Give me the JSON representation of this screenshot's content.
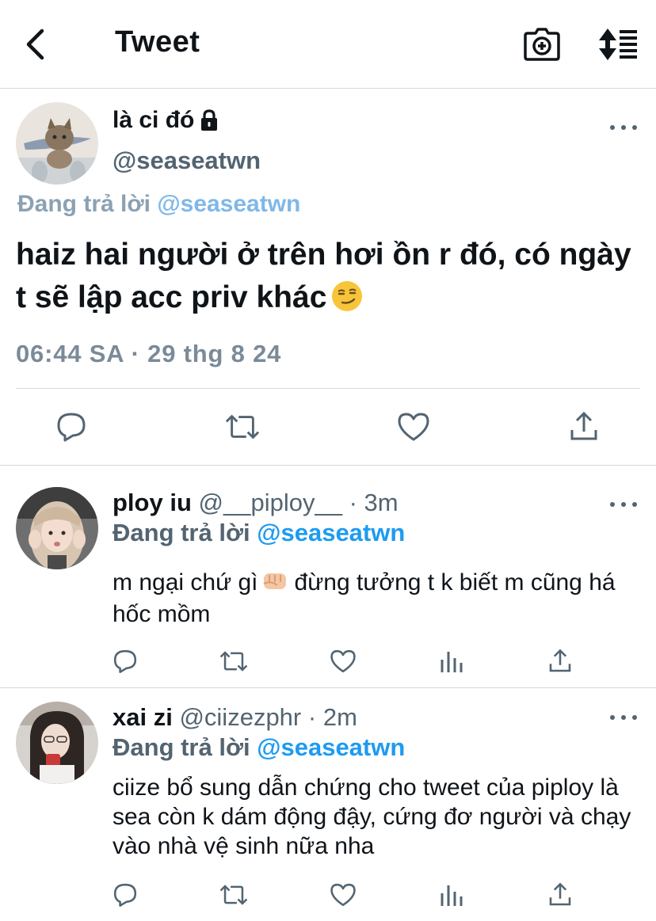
{
  "header": {
    "title": "Tweet",
    "back_icon": "chevron-left-icon",
    "camera_icon": "camera-icon",
    "sort_icon": "sort-icon"
  },
  "main_tweet": {
    "display_name": "là ci đó",
    "handle": "@seaseatwn",
    "replying_prefix": "Đang trả lời",
    "replying_to": "@seaseatwn",
    "text": "haiz hai người ở trên hơi ồn r đó, có ngày t sẽ lập acc priv khác",
    "emoji": "smirking-face",
    "timestamp": "06:44 SA · 29 thg 8 24",
    "actions": [
      "reply-icon",
      "retweet-icon",
      "like-icon",
      "share-icon"
    ]
  },
  "replies": [
    {
      "display_name": "ploy iu",
      "handle": "@__piploy__",
      "dot": "·",
      "time": "3m",
      "replying_prefix": "Đang trả lời",
      "replying_to": "@seaseatwn",
      "text_part1": "m ngại chứ gì",
      "emoji": "fist-emoji",
      "text_part2": "đừng tưởng t k biết m cũng há hốc mồm"
    },
    {
      "display_name": "xai zi",
      "handle": "@ciizezphr",
      "dot": "·",
      "time": "2m",
      "replying_prefix": "Đang trả lời",
      "replying_to": "@seaseatwn",
      "text": "ciize bổ sung dẫn chứng cho tweet của piploy là sea còn k dám động đậy, cứng đơ người và chạy vào nhà vệ sinh nữa nha"
    }
  ],
  "colors": {
    "text": "#0f1419",
    "secondary": "#536471",
    "link": "#1d9bf0",
    "divider": "#d5d9dc",
    "icon": "#536471"
  }
}
